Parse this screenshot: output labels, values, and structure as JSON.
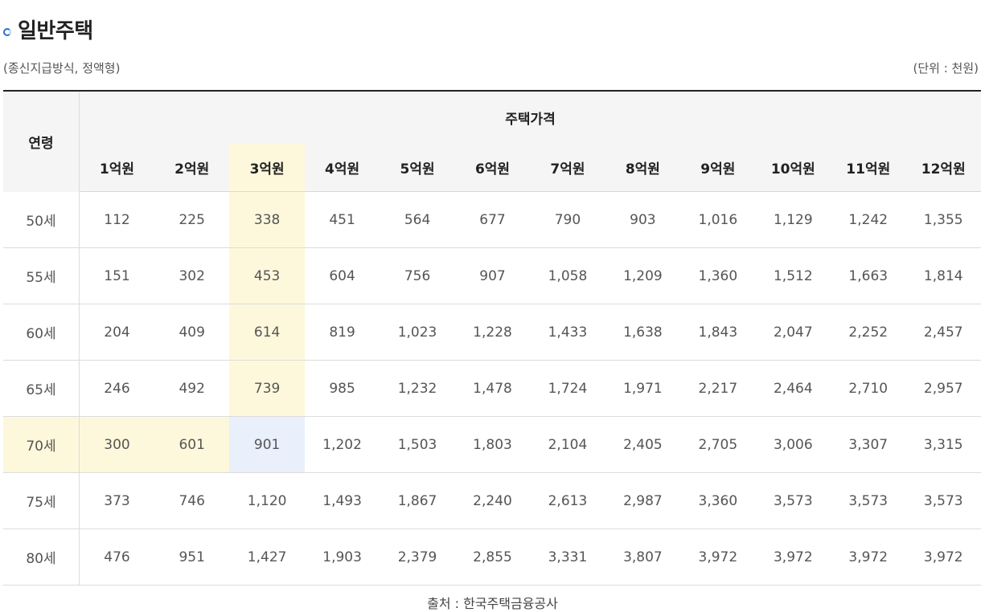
{
  "title": "일반주택",
  "subtitle_left": "(종신지급방식, 정액형)",
  "subtitle_right": "(단위 : 천원)",
  "table": {
    "age_header": "연령",
    "price_header": "주택가격",
    "columns": [
      "1억원",
      "2억원",
      "3억원",
      "4억원",
      "5억원",
      "6억원",
      "7억원",
      "8억원",
      "9억원",
      "10억원",
      "11억원",
      "12억원"
    ],
    "rows": [
      {
        "age": "50세",
        "values": [
          "112",
          "225",
          "338",
          "451",
          "564",
          "677",
          "790",
          "903",
          "1,016",
          "1,129",
          "1,242",
          "1,355"
        ]
      },
      {
        "age": "55세",
        "values": [
          "151",
          "302",
          "453",
          "604",
          "756",
          "907",
          "1,058",
          "1,209",
          "1,360",
          "1,512",
          "1,663",
          "1,814"
        ]
      },
      {
        "age": "60세",
        "values": [
          "204",
          "409",
          "614",
          "819",
          "1,023",
          "1,228",
          "1,433",
          "1,638",
          "1,843",
          "2,047",
          "2,252",
          "2,457"
        ]
      },
      {
        "age": "65세",
        "values": [
          "246",
          "492",
          "739",
          "985",
          "1,232",
          "1,478",
          "1,724",
          "1,971",
          "2,217",
          "2,464",
          "2,710",
          "2,957"
        ]
      },
      {
        "age": "70세",
        "values": [
          "300",
          "601",
          "901",
          "1,202",
          "1,503",
          "1,803",
          "2,104",
          "2,405",
          "2,705",
          "3,006",
          "3,307",
          "3,315"
        ]
      },
      {
        "age": "75세",
        "values": [
          "373",
          "746",
          "1,120",
          "1,493",
          "1,867",
          "2,240",
          "2,613",
          "2,987",
          "3,360",
          "3,573",
          "3,573",
          "3,573"
        ]
      },
      {
        "age": "80세",
        "values": [
          "476",
          "951",
          "1,427",
          "1,903",
          "2,379",
          "2,855",
          "3,331",
          "3,807",
          "3,972",
          "3,972",
          "3,972",
          "3,972"
        ]
      }
    ]
  },
  "source": "출처 : 한국주택금융공사",
  "colors": {
    "highlight_yellow": "#fdf8dc",
    "highlight_blue": "#e9f0fb",
    "bullet": "#2a6fd6"
  }
}
